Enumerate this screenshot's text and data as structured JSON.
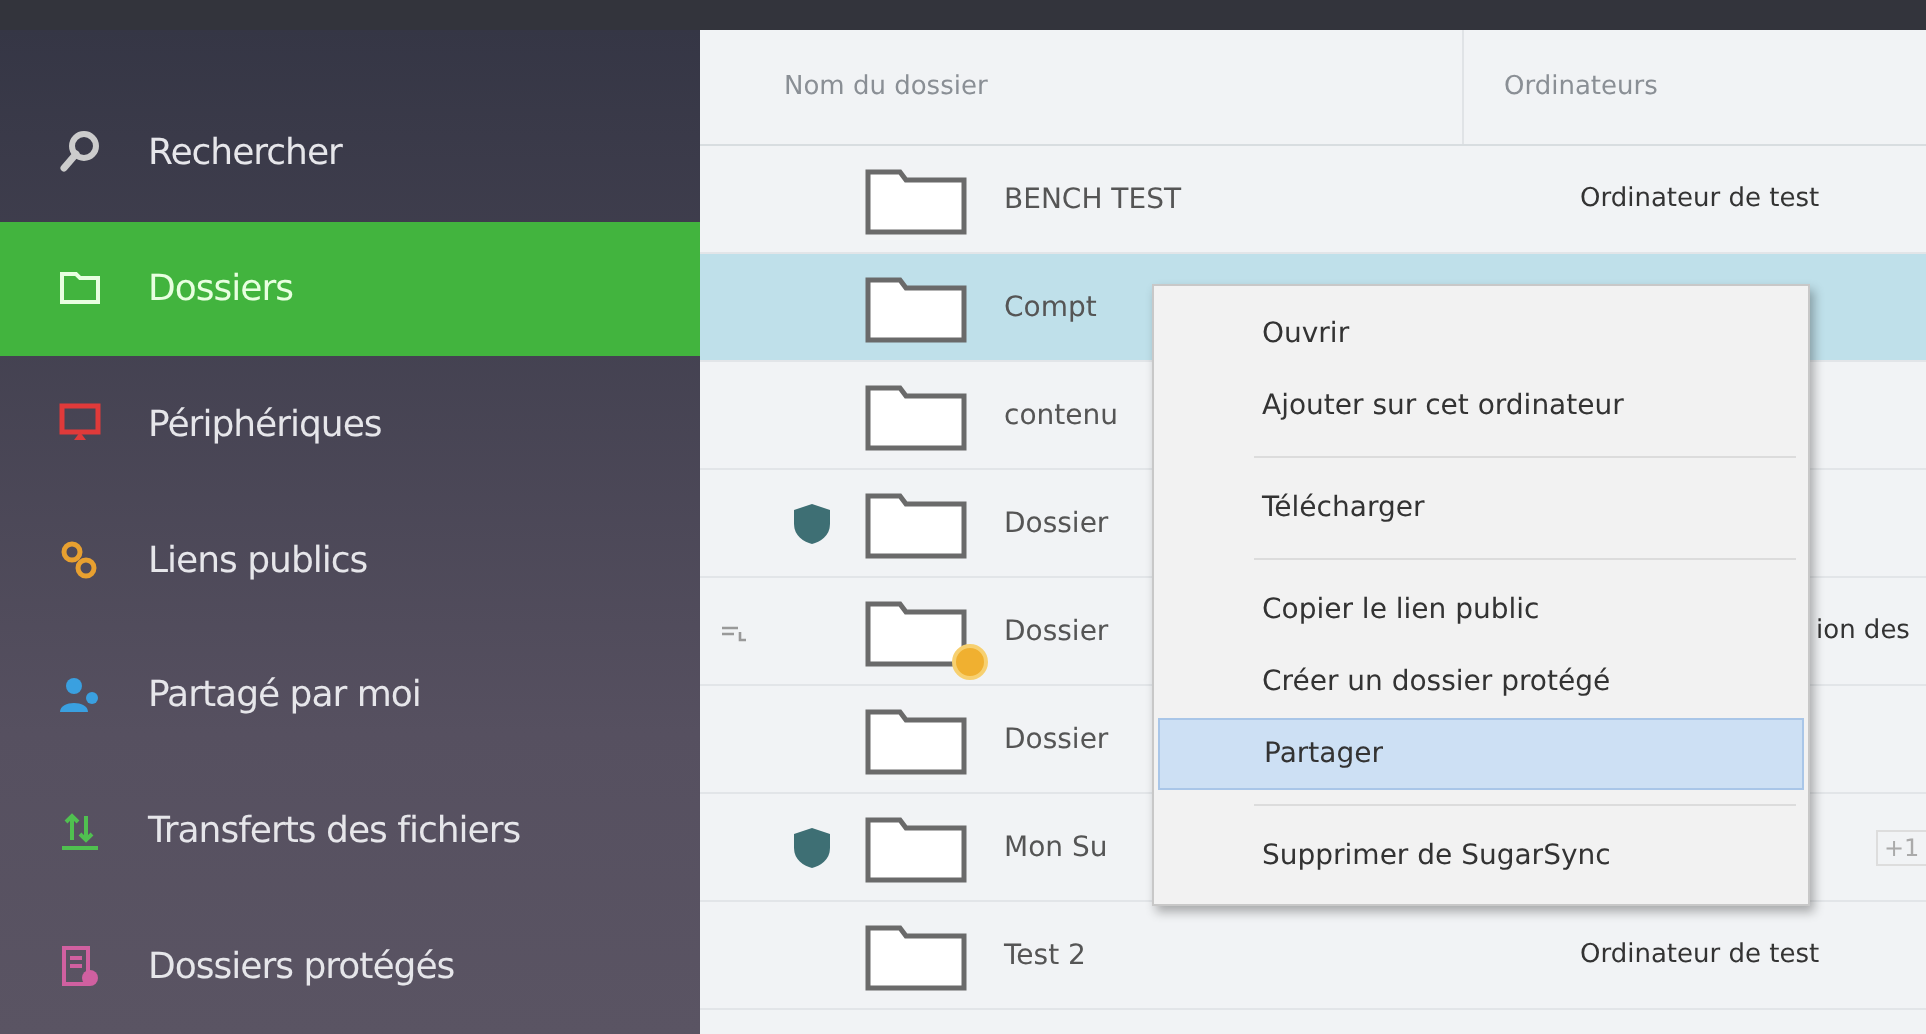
{
  "sidebar": {
    "items": [
      {
        "label": "Rechercher",
        "selected": false
      },
      {
        "label": "Dossiers",
        "selected": true
      },
      {
        "label": "Périphériques",
        "selected": false
      },
      {
        "label": "Liens publics",
        "selected": false
      },
      {
        "label": "Partagé par moi",
        "selected": false
      },
      {
        "label": "Transferts des fichiers",
        "selected": false
      },
      {
        "label": "Dossiers protégés",
        "selected": false
      }
    ]
  },
  "table": {
    "columns": [
      "Nom du dossier",
      "Ordinateurs"
    ],
    "rows": [
      {
        "name": "BENCH TEST",
        "computer": "Ordinateur de test",
        "selected": false,
        "protected": false,
        "synced": false,
        "alert": false
      },
      {
        "name": "Compt",
        "selected": true,
        "protected": false,
        "synced": false,
        "alert": false
      },
      {
        "name": "contenu",
        "selected": false,
        "protected": false,
        "synced": false,
        "alert": false
      },
      {
        "name": "Dossier",
        "selected": false,
        "protected": true,
        "synced": false,
        "alert": false
      },
      {
        "name": "Dossier",
        "computer": "ion des",
        "selected": false,
        "protected": false,
        "synced": true,
        "alert": true
      },
      {
        "name": "Dossier",
        "selected": false,
        "protected": false,
        "synced": false,
        "alert": false
      },
      {
        "name": "Mon Su",
        "tag": "+1",
        "selected": false,
        "protected": true,
        "synced": false,
        "alert": false
      },
      {
        "name": "Test 2",
        "computer": "Ordinateur de test",
        "selected": false,
        "protected": false,
        "synced": false,
        "alert": false
      }
    ]
  },
  "context_menu": {
    "items": [
      {
        "kind": "item",
        "label": "Ouvrir",
        "selected": false
      },
      {
        "kind": "item",
        "label": "Ajouter sur cet ordinateur",
        "selected": false
      },
      {
        "kind": "separator"
      },
      {
        "kind": "item",
        "label": "Télécharger",
        "selected": false
      },
      {
        "kind": "separator"
      },
      {
        "kind": "item",
        "label": "Copier le lien public",
        "selected": false
      },
      {
        "kind": "item",
        "label": "Créer un dossier protégé",
        "selected": false
      },
      {
        "kind": "item",
        "label": "Partager",
        "selected": true
      },
      {
        "kind": "separator"
      },
      {
        "kind": "item",
        "label": "Supprimer de SugarSync",
        "selected": false
      }
    ]
  }
}
